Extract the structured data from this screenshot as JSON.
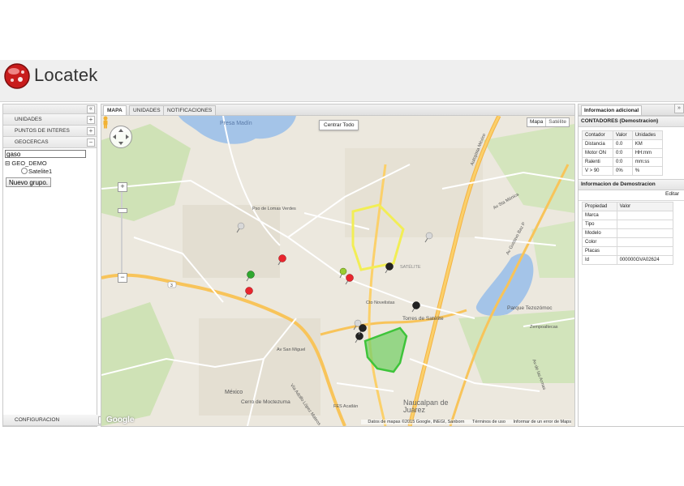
{
  "brand": {
    "name": "Locatek"
  },
  "left_panel": {
    "collapse_symbol": "«",
    "sections": [
      {
        "label": "UNIDADES",
        "toggle": "+"
      },
      {
        "label": "PUNTOS DE INTERES",
        "toggle": "+"
      },
      {
        "label": "GEOCERCAS",
        "toggle": "−"
      }
    ],
    "search_value": "gaso",
    "tree": {
      "group": "GEO_DEMO",
      "item": "Satelite1",
      "expander": "⊟"
    },
    "new_group_button": "Nuevo grupo.",
    "footer": {
      "label": "CONFIGURACION",
      "toggle": "+"
    }
  },
  "center": {
    "tabs": [
      "MAPA",
      "UNIDADES",
      "NOTIFICACIONES"
    ],
    "active_tab": "MAPA",
    "center_button": "Centrar Todo",
    "map_types": [
      "Mapa",
      "Satélite"
    ],
    "zoom_in": "+",
    "zoom_out": "−",
    "google_logo": "Google",
    "attribution": [
      "Datos de mapas ©2015 Google, INEGI, Sanborn",
      "Términos de uso",
      "Informar de un error de Maps"
    ],
    "map_labels": {
      "presa_madin": "Presa Madín",
      "mexico": "México",
      "cerro": "Cerro de Moctezuma",
      "naucalpan": "Naucalpan de Juárez",
      "fes": "FES Acatlán",
      "parque": "Parque Tezozómoc",
      "torres": "Torres de Satélite",
      "satelite": "SATÉLITE",
      "cto_novelistas": "Cto Novelistas",
      "av_san_miguel": "Av San Miguel",
      "lopez_mateos": "Vía Adolfo López Mateos",
      "autopista": "Autopista México",
      "gustavo_baz": "Av Gustavo Baz P",
      "zempoaltecas": "Zempoaltecas",
      "las_armas": "Av de las Armas",
      "lomas_verdes": "Pso de Lomas Verdes",
      "av_sta_monica": "Av Sta Mónica",
      "road_num": "3"
    },
    "colors": {
      "water": "#a4c4e8",
      "park": "#c6dfa8",
      "highway": "#f9b94a",
      "road": "#ffffff",
      "geofence_yellow": "#f2ee55",
      "geofence_green": "#3ec43a",
      "geofence_green_fill": "#7ad06a"
    },
    "pins": [
      {
        "color": "#d8d8d8"
      },
      {
        "color": "#e8252e"
      },
      {
        "color": "#2fa82f"
      },
      {
        "color": "#e8252e"
      },
      {
        "color": "#e8252e"
      },
      {
        "color": "#99cc33"
      },
      {
        "color": "#222222"
      },
      {
        "color": "#d8d8d8"
      },
      {
        "color": "#222222"
      },
      {
        "color": "#222222"
      },
      {
        "color": "#222222"
      },
      {
        "color": "#d8d8d8"
      }
    ]
  },
  "right_panel": {
    "expand_symbol": "»",
    "tab": "Informacion adicional",
    "counters_title": "CONTADORES (Demostracion)",
    "counters_headers": [
      "Contador",
      "Valor",
      "Unidades"
    ],
    "counters_rows": [
      [
        "Distancia",
        "0.0",
        "KM"
      ],
      [
        "Motor ON",
        "0:0",
        "HH:mm"
      ],
      [
        "Ralenti",
        "0:0",
        "mm:ss"
      ],
      [
        "V > 90",
        "0%",
        "%"
      ]
    ],
    "demo_title": "Informacion de Demostracion",
    "edit_label": "Editar",
    "demo_headers": [
      "Propiedad",
      "Valor"
    ],
    "demo_rows": [
      [
        "Marca",
        ""
      ],
      [
        "Tipo",
        ""
      ],
      [
        "Modelo",
        ""
      ],
      [
        "Color",
        ""
      ],
      [
        "Placas",
        ""
      ],
      [
        "Id",
        "000000GVA02624"
      ]
    ]
  }
}
